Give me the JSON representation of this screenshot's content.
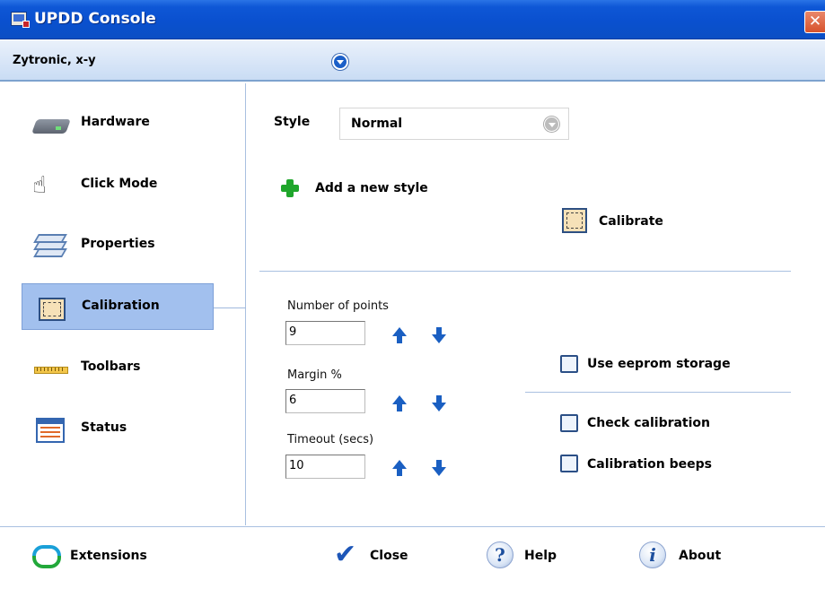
{
  "window": {
    "title": "UPDD Console",
    "close_glyph": "✕"
  },
  "device": {
    "name": "Zytronic, x-y"
  },
  "sidebar": {
    "items": [
      {
        "label": "Hardware",
        "icon": "hardware-icon"
      },
      {
        "label": "Click Mode",
        "icon": "hand-pointer-icon"
      },
      {
        "label": "Properties",
        "icon": "layers-icon"
      },
      {
        "label": "Calibration",
        "icon": "calibration-icon",
        "selected": true
      },
      {
        "label": "Toolbars",
        "icon": "ruler-icon"
      },
      {
        "label": "Status",
        "icon": "status-window-icon"
      }
    ]
  },
  "main": {
    "style_label": "Style",
    "style_value": "Normal",
    "add_style_label": "Add a new style",
    "calibrate_label": "Calibrate",
    "fields": {
      "points": {
        "label": "Number of points",
        "value": "9"
      },
      "margin": {
        "label": "Margin %",
        "value": "6"
      },
      "timeout": {
        "label": "Timeout (secs)",
        "value": "10"
      }
    },
    "options": {
      "eeprom": {
        "label": "Use eeprom storage",
        "checked": false
      },
      "check_calibration": {
        "label": "Check calibration",
        "checked": false
      },
      "calibration_beeps": {
        "label": "Calibration beeps",
        "checked": false
      }
    }
  },
  "footer": {
    "extensions": "Extensions",
    "close": "Close",
    "help": "Help",
    "about": "About",
    "help_glyph": "?",
    "about_glyph": "i",
    "close_glyph": "✔"
  },
  "colors": {
    "titlebar": "#0a50cf",
    "selection": "#a2c0ee",
    "arrow_blue": "#1a5fc2",
    "accent_green": "#1fa62b"
  }
}
